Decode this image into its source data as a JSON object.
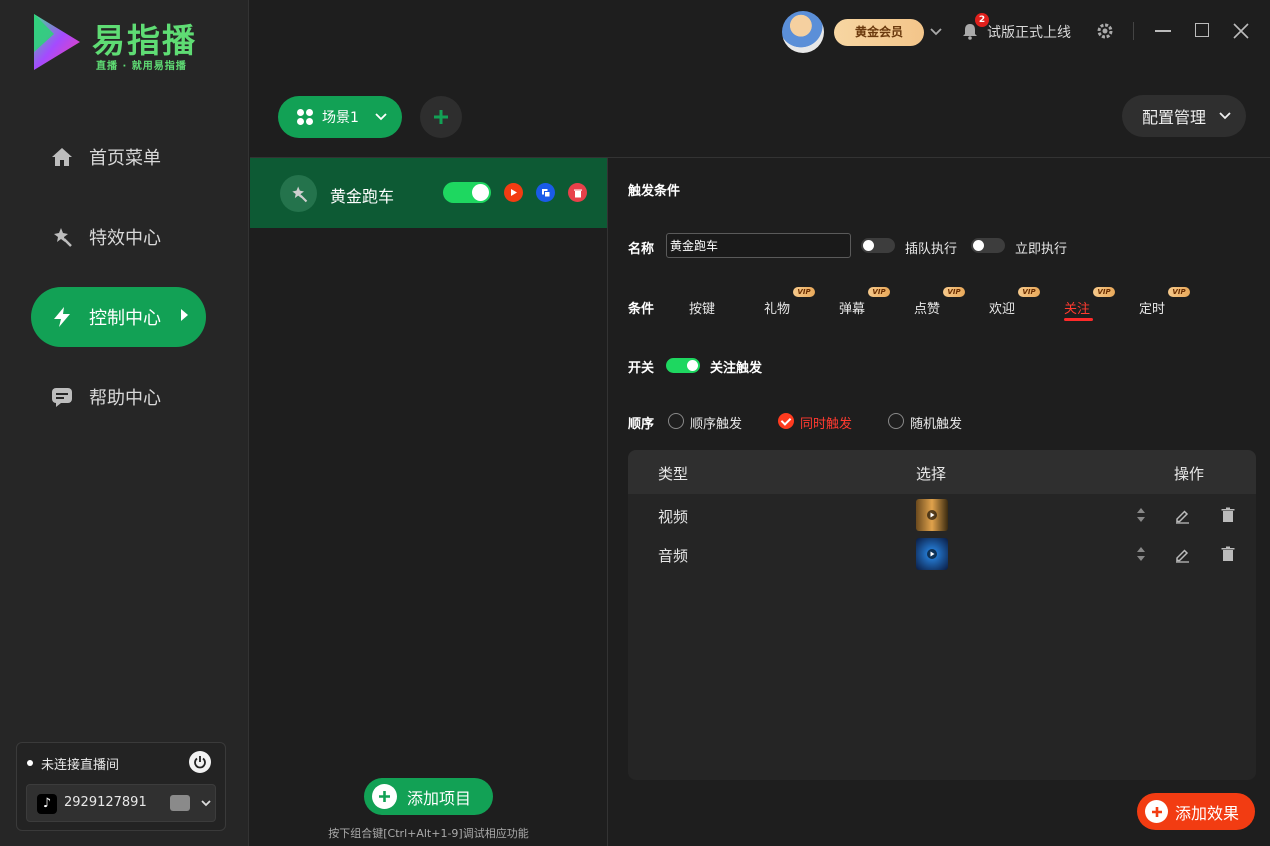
{
  "app": {
    "title": "易指播",
    "slogan": "直播 · 就用易指播"
  },
  "sidebar": {
    "items": [
      {
        "label": "首页菜单",
        "icon": "home-icon"
      },
      {
        "label": "特效中心",
        "icon": "magic-wand-icon"
      },
      {
        "label": "控制中心",
        "icon": "lightning-icon",
        "active": true
      },
      {
        "label": "帮助中心",
        "icon": "chat-icon"
      }
    ],
    "connection": {
      "status": "未连接直播间",
      "account": "2929127891",
      "platform_icon": "tiktok-icon"
    }
  },
  "topbar": {
    "member_badge": "黄金会员",
    "notification_count": "2",
    "notice": "试版正式上线"
  },
  "scene": {
    "current": "场景1",
    "config_label": "配置管理"
  },
  "projects": {
    "items": [
      {
        "name": "黄金跑车",
        "enabled": true
      }
    ],
    "add_label": "添加项目",
    "hint": "按下组合键[Ctrl+Alt+1-9]调试相应功能"
  },
  "trigger": {
    "section_title": "触发条件",
    "name_label": "名称",
    "name_value": "黄金跑车",
    "queue_label": "插队执行",
    "immediate_label": "立即执行",
    "condition_label": "条件",
    "tabs": [
      {
        "label": "按键",
        "vip": false
      },
      {
        "label": "礼物",
        "vip": true
      },
      {
        "label": "弹幕",
        "vip": true
      },
      {
        "label": "点赞",
        "vip": true
      },
      {
        "label": "欢迎",
        "vip": true
      },
      {
        "label": "关注",
        "vip": true,
        "active": true
      },
      {
        "label": "定时",
        "vip": true
      }
    ],
    "vip_text": "VIP",
    "switch_label": "开关",
    "switch_text": "关注触发",
    "order_label": "顺序",
    "order_options": [
      {
        "label": "顺序触发",
        "selected": false
      },
      {
        "label": "同时触发",
        "selected": true
      },
      {
        "label": "随机触发",
        "selected": false
      }
    ]
  },
  "effects_table": {
    "headers": [
      "类型",
      "选择",
      "操作"
    ],
    "rows": [
      {
        "type": "视频"
      },
      {
        "type": "音频"
      }
    ],
    "add_label": "添加效果"
  },
  "colors": {
    "accent_green": "#12a155",
    "toggle_green": "#1ed760",
    "accent_red": "#f23c12",
    "gold": "#f3c58a"
  }
}
